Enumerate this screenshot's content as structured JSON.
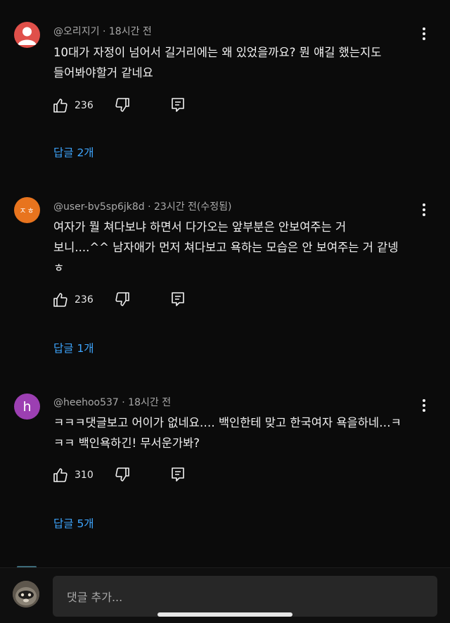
{
  "comments": [
    {
      "author": "@오리지기",
      "time": "· 18시간 전",
      "text": "10대가 자정이 넘어서 길거리에는 왜 있었을까요? 뭔 얘길 했는지도\n들어봐야할거 같네요",
      "likes": "236",
      "replies": "답글 2개",
      "avatar_color": "#e0504a"
    },
    {
      "author": "@user-bv5sp6jk8d",
      "time": "· 23시간 전(수정됨)",
      "text": "여자가 뭘 쳐다보냐 하면서 다가오는 앞부분은 안보여주는 거\n보니....^^ 남자애가 먼저 쳐다보고 욕하는 모습은 안 보여주는 거 같넹\nㅎ",
      "likes": "236",
      "replies": "답글 1개",
      "avatar_text": "ㅈㅎ",
      "avatar_color": "#e8741e"
    },
    {
      "author": "@heehoo537",
      "time": "· 18시간 전",
      "text": "ㅋㅋㅋ댓글보고 어이가 없네요…. 백인한테 맞고 한국여자 욕을하네…ㅋ\nㅋㅋ 백인욕하긴! 무서운가봐?",
      "likes": "310",
      "replies": "답글 5개",
      "avatar_text": "h",
      "avatar_color": "#9c3fb2"
    }
  ],
  "comment_input": {
    "placeholder": "댓글 추가..."
  },
  "colors": {
    "background": "#0b0b0b",
    "link": "#3ea6ff",
    "input_bg": "#272727"
  }
}
